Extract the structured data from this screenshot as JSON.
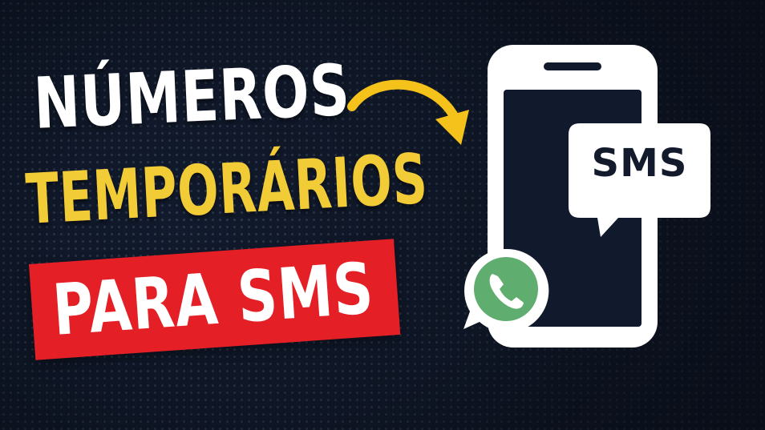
{
  "headline": {
    "line1": "NÚMEROS",
    "line2": "TEMPORÁRIOS",
    "line3": "PARA SMS"
  },
  "illustration": {
    "bubble_text": "SMS",
    "icons": [
      "curved-arrow-icon",
      "smartphone-icon",
      "chat-bubble-icon",
      "whatsapp-icon"
    ]
  },
  "colors": {
    "background": "#111a2c",
    "line1_text": "#ffffff",
    "line2_text": "#f2cc36",
    "banner": "#e41f26",
    "arrow": "#f5c21b",
    "whatsapp_green": "#5fae6f",
    "phone": "#ffffff"
  }
}
